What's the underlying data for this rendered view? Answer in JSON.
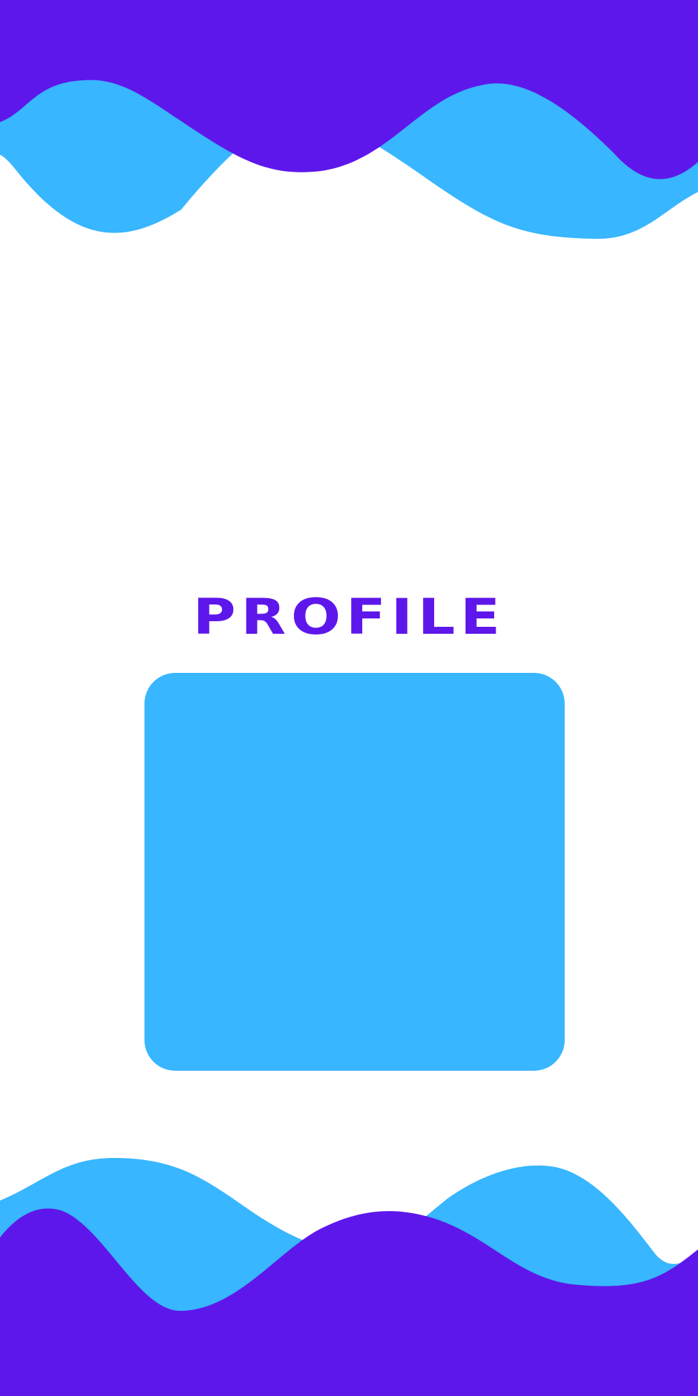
{
  "colors": {
    "purple": "#5E17EB",
    "blue": "#38B6FF",
    "background": "#FFFFFF"
  },
  "title": "PROFILE"
}
